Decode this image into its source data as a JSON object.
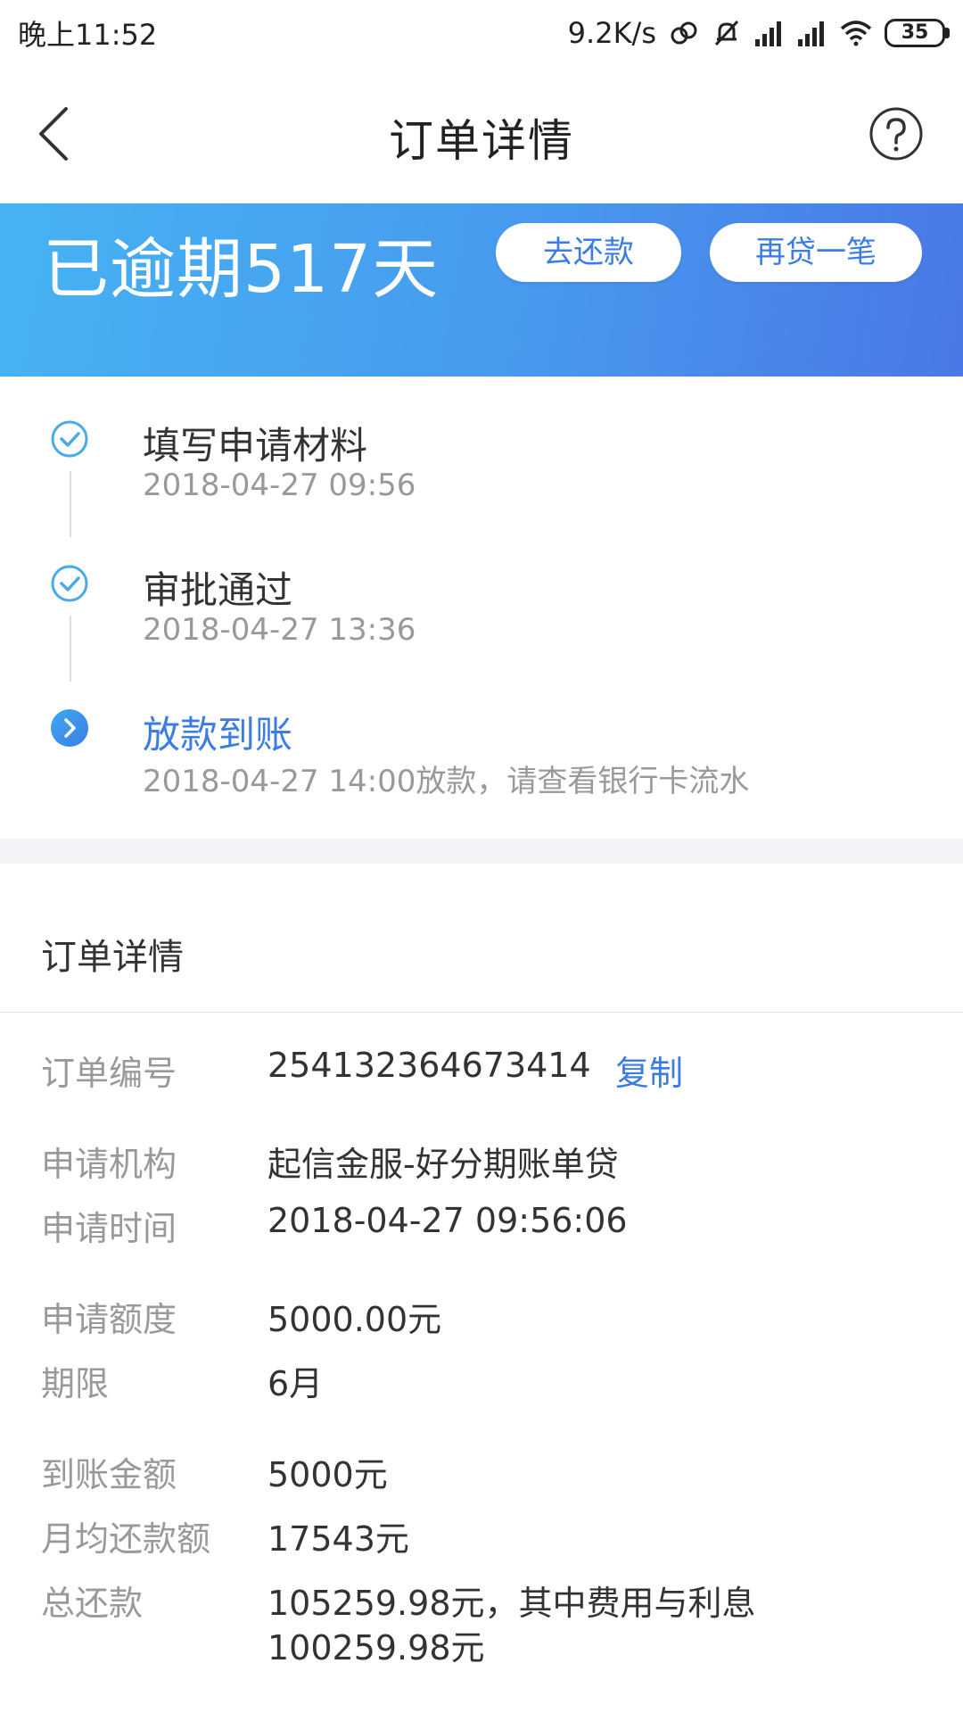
{
  "status_bar": {
    "time": "晚上11:52",
    "net_speed": "9.2K/s",
    "battery": "35"
  },
  "header": {
    "title": "订单详情"
  },
  "banner": {
    "overdue_text": "已逾期517天",
    "repay_label": "去还款",
    "reloan_label": "再贷一笔"
  },
  "timeline": [
    {
      "title": "填写申请材料",
      "time": "2018-04-27 09:56",
      "status": "done"
    },
    {
      "title": "审批通过",
      "time": "2018-04-27 13:36",
      "status": "done"
    },
    {
      "title": "放款到账",
      "time": "2018-04-27 14:00放款，请查看银行卡流水",
      "status": "current"
    }
  ],
  "details": {
    "section_title": "订单详情",
    "copy_label": "复制",
    "rows": [
      {
        "label": "订单编号",
        "value": "254132364673414"
      },
      {
        "label": "申请机构",
        "value": "起信金服-好分期账单贷"
      },
      {
        "label": "申请时间",
        "value": "2018-04-27 09:56:06"
      },
      {
        "label": "申请额度",
        "value": "5000.00元"
      },
      {
        "label": "期限",
        "value": "6月"
      },
      {
        "label": "到账金额",
        "value": "5000元"
      },
      {
        "label": "月均还款额",
        "value": "17543元"
      },
      {
        "label": "总还款",
        "value_line1": "105259.98元，其中费用与利息",
        "value_line2": "100259.98元"
      }
    ]
  },
  "colors": {
    "accent": "#3b7de4",
    "banner_start": "#46b3f3",
    "banner_end": "#4a78e6",
    "muted_text": "#999999"
  },
  "icons": [
    "back-arrow-icon",
    "help-circle-icon",
    "check-circle-icon",
    "arrow-circle-icon",
    "link-icon",
    "mute-bell-icon",
    "signal-icon",
    "wifi-icon",
    "battery-icon"
  ]
}
